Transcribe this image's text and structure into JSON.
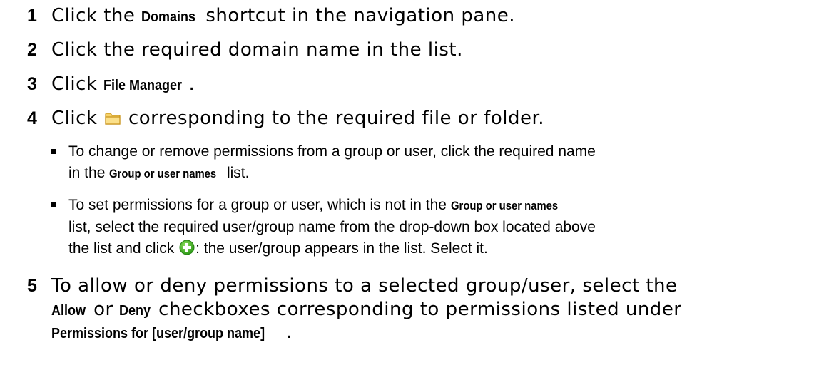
{
  "steps": [
    {
      "num": "1",
      "before": "Click the ",
      "bold": "Domains",
      "after": " shortcut in the navigation pane."
    },
    {
      "num": "2",
      "text": "Click the required domain name in the list."
    },
    {
      "num": "3",
      "before": "Click ",
      "bold": "File Manager",
      "after": "."
    },
    {
      "num": "4",
      "before": "Click ",
      "icon": "folder-icon",
      "after": " corresponding to the required file or folder."
    },
    {
      "num": "5",
      "line1": "To allow or deny permissions to a selected group/user, select the",
      "line2_b1": "Allow",
      "line2_t1": " or ",
      "line2_b2": "Deny",
      "line2_t2": " checkboxes corresponding to permissions listed under",
      "line3_b": "Permissions for [user/group name]",
      "line3_t": "."
    }
  ],
  "bullets": [
    {
      "line1": "To change or remove permissions from a group or user, click the required name",
      "line2_before": "in the ",
      "line2_bold": "Group or user names",
      "line2_after": " list."
    },
    {
      "line1_before": "To set permissions for a group or user, which is not in the ",
      "line1_bold": "Group or user names",
      "line2": "list, select the required user/group name from the drop-down box located above",
      "line3_before": "the list and click ",
      "icon": "add-icon",
      "line3_after": ": the user/group appears in the list. Select it."
    }
  ]
}
